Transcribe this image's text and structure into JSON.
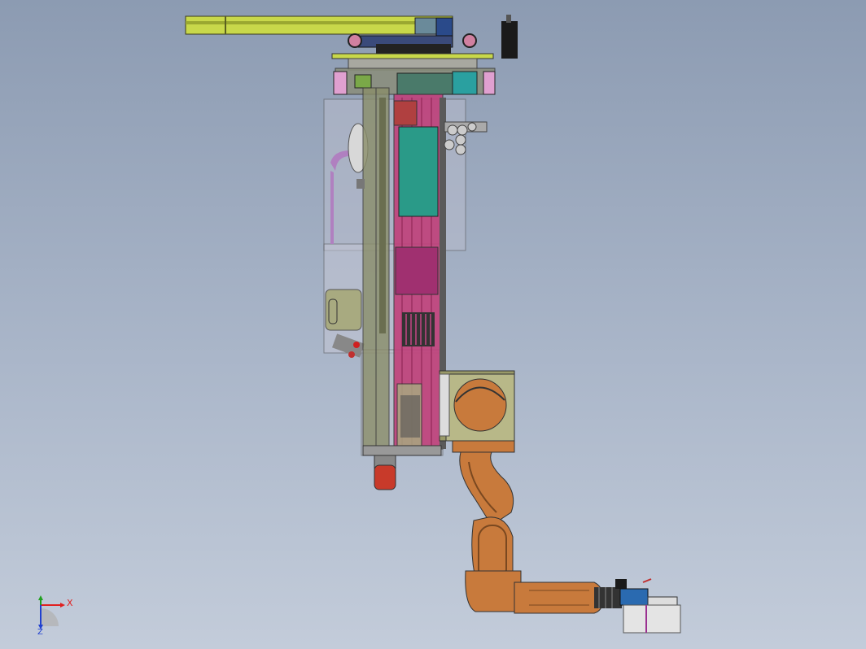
{
  "viewport": {
    "background_top": "#8c9bb2",
    "background_bottom": "#c3ccda"
  },
  "colors": {
    "rail_yellow": "#c8d84a",
    "frame_olive": "#8a8e6a",
    "carriage_magenta": "#c0407a",
    "motor_teal": "#2a9a88",
    "robot_orange": "#c87a3c",
    "gripper_blue": "#2a6ab0",
    "cap_red": "#c83a2a"
  },
  "triad": {
    "x_label": "X",
    "z_label": "Z",
    "icon": "coordinate-triad-icon"
  }
}
